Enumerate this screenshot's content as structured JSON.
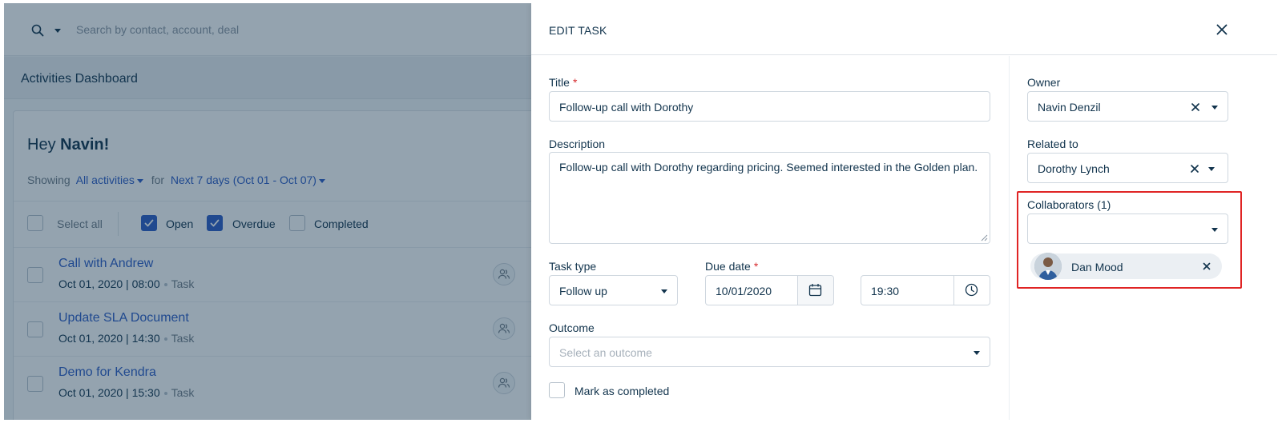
{
  "search": {
    "placeholder": "Search by contact, account, deal"
  },
  "dashboard": {
    "title": "Activities Dashboard",
    "greeting_prefix": "Hey",
    "greeting_name": "Navin!",
    "showing_label": "Showing",
    "activity_filter": "All activities",
    "for_label": "for",
    "date_filter": "Next 7 days (Oct 01 - Oct 07)",
    "select_all": "Select all",
    "status_filters": [
      {
        "label": "Open",
        "checked": true
      },
      {
        "label": "Overdue",
        "checked": true
      },
      {
        "label": "Completed",
        "checked": false
      }
    ],
    "activities": [
      {
        "title": "Call with Andrew",
        "when": "Oct 01, 2020 | 08:00",
        "type": "Task"
      },
      {
        "title": "Update SLA Document",
        "when": "Oct 01, 2020 | 14:30",
        "type": "Task"
      },
      {
        "title": "Demo for Kendra",
        "when": "Oct 01, 2020 | 15:30",
        "type": "Task"
      }
    ]
  },
  "edit_task": {
    "heading": "EDIT TASK",
    "title_label": "Title",
    "title_value": "Follow-up call with Dorothy",
    "description_label": "Description",
    "description_value": "Follow-up call with Dorothy regarding pricing. Seemed interested in the Golden plan.",
    "task_type_label": "Task type",
    "task_type_value": "Follow up",
    "due_date_label": "Due date",
    "due_date_value": "10/01/2020",
    "due_time_value": "19:30",
    "outcome_label": "Outcome",
    "outcome_placeholder": "Select an outcome",
    "mark_completed_label": "Mark as completed",
    "owner_label": "Owner",
    "owner_value": "Navin Denzil",
    "related_label": "Related to",
    "related_value": "Dorothy Lynch",
    "collaborators_label": "Collaborators (1)",
    "collaborators": [
      {
        "name": "Dan Mood"
      }
    ]
  },
  "colors": {
    "link": "#2c5cc5",
    "required": "#d72d30",
    "highlight": "#e02424",
    "checkbox_checked": "#2c5cc5"
  },
  "icons": [
    "search-icon",
    "caret-down-icon",
    "checkmark-icon",
    "people-icon",
    "close-icon",
    "calendar-icon",
    "clock-icon",
    "chevron-down-icon",
    "clear-icon",
    "resize-handle-icon"
  ]
}
